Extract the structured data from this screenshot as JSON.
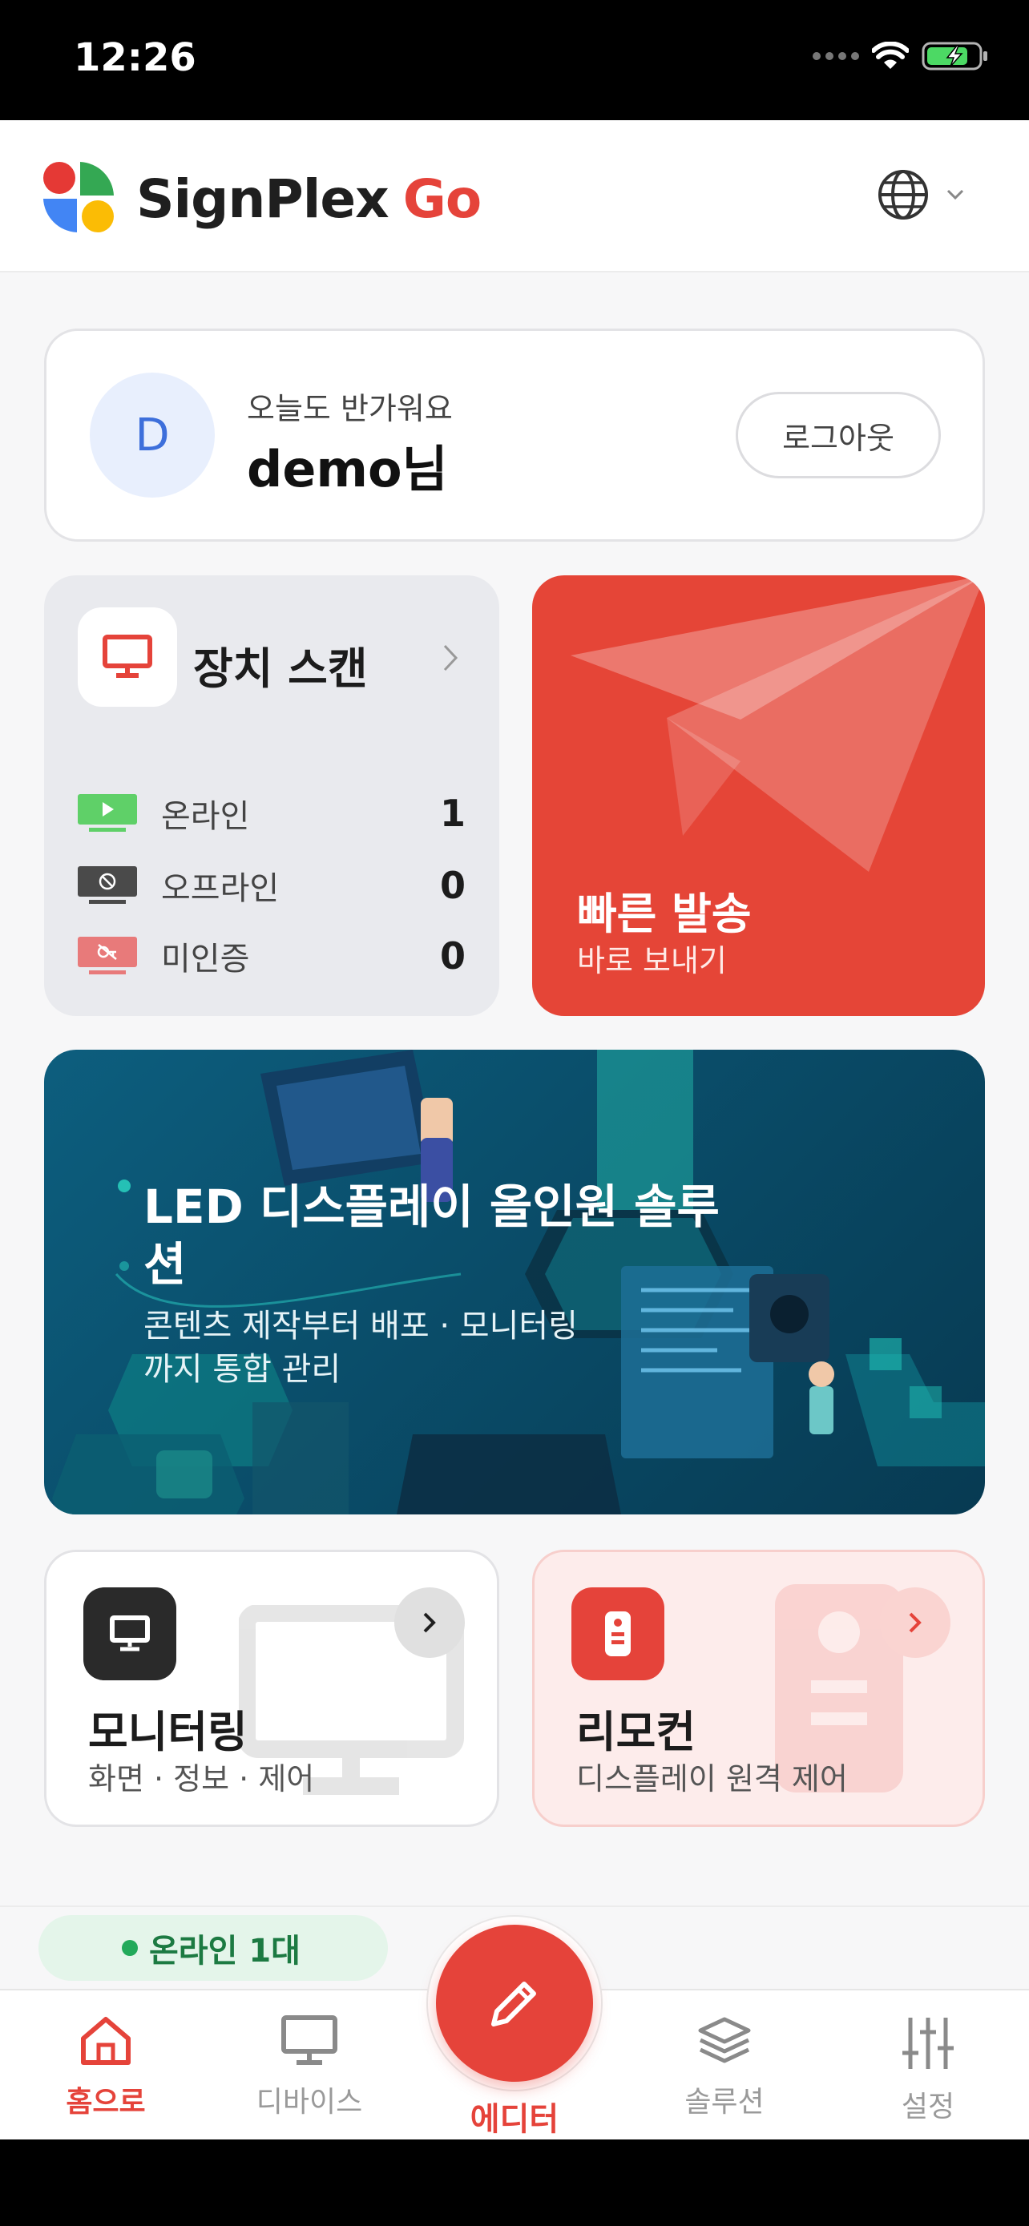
{
  "status_bar": {
    "time": "12:26"
  },
  "app": {
    "brand": "SignPlex",
    "brand_accent": "Go"
  },
  "greeting": {
    "avatar_letter": "D",
    "subtitle": "오늘도 반가워요",
    "name": "demo님",
    "logout_label": "로그아웃"
  },
  "scan": {
    "title": "장치 스캔",
    "stats": [
      {
        "label": "온라인",
        "value": "1",
        "color": "#5fd068"
      },
      {
        "label": "오프라인",
        "value": "0",
        "color": "#4a4a4a"
      },
      {
        "label": "미인증",
        "value": "0",
        "color": "#e87a7a"
      }
    ]
  },
  "quick_send": {
    "title": "빠른 발송",
    "subtitle": "바로 보내기"
  },
  "banner": {
    "title": "LED 디스플레이 올인원 솔루션",
    "subtitle": "콘텐츠 제작부터 배포 · 모니터링까지 통합 관리"
  },
  "features": [
    {
      "title": "모니터링",
      "subtitle": "화면 · 정보 · 제어",
      "icon": "monitor-icon"
    },
    {
      "title": "리모컨",
      "subtitle": "디스플레이 원격 제어",
      "icon": "remote-icon"
    }
  ],
  "online_status": {
    "label": "온라인 1대"
  },
  "tabs": [
    {
      "label": "홈으로",
      "icon": "home-icon",
      "active": true
    },
    {
      "label": "디바이스",
      "icon": "monitor-icon",
      "active": false
    },
    {
      "label": "에디터",
      "icon": "pencil-icon",
      "active": true
    },
    {
      "label": "솔루션",
      "icon": "layers-icon",
      "active": false
    },
    {
      "label": "설정",
      "icon": "sliders-icon",
      "active": false
    }
  ],
  "colors": {
    "accent": "#e5433a",
    "online": "#22a95a"
  }
}
